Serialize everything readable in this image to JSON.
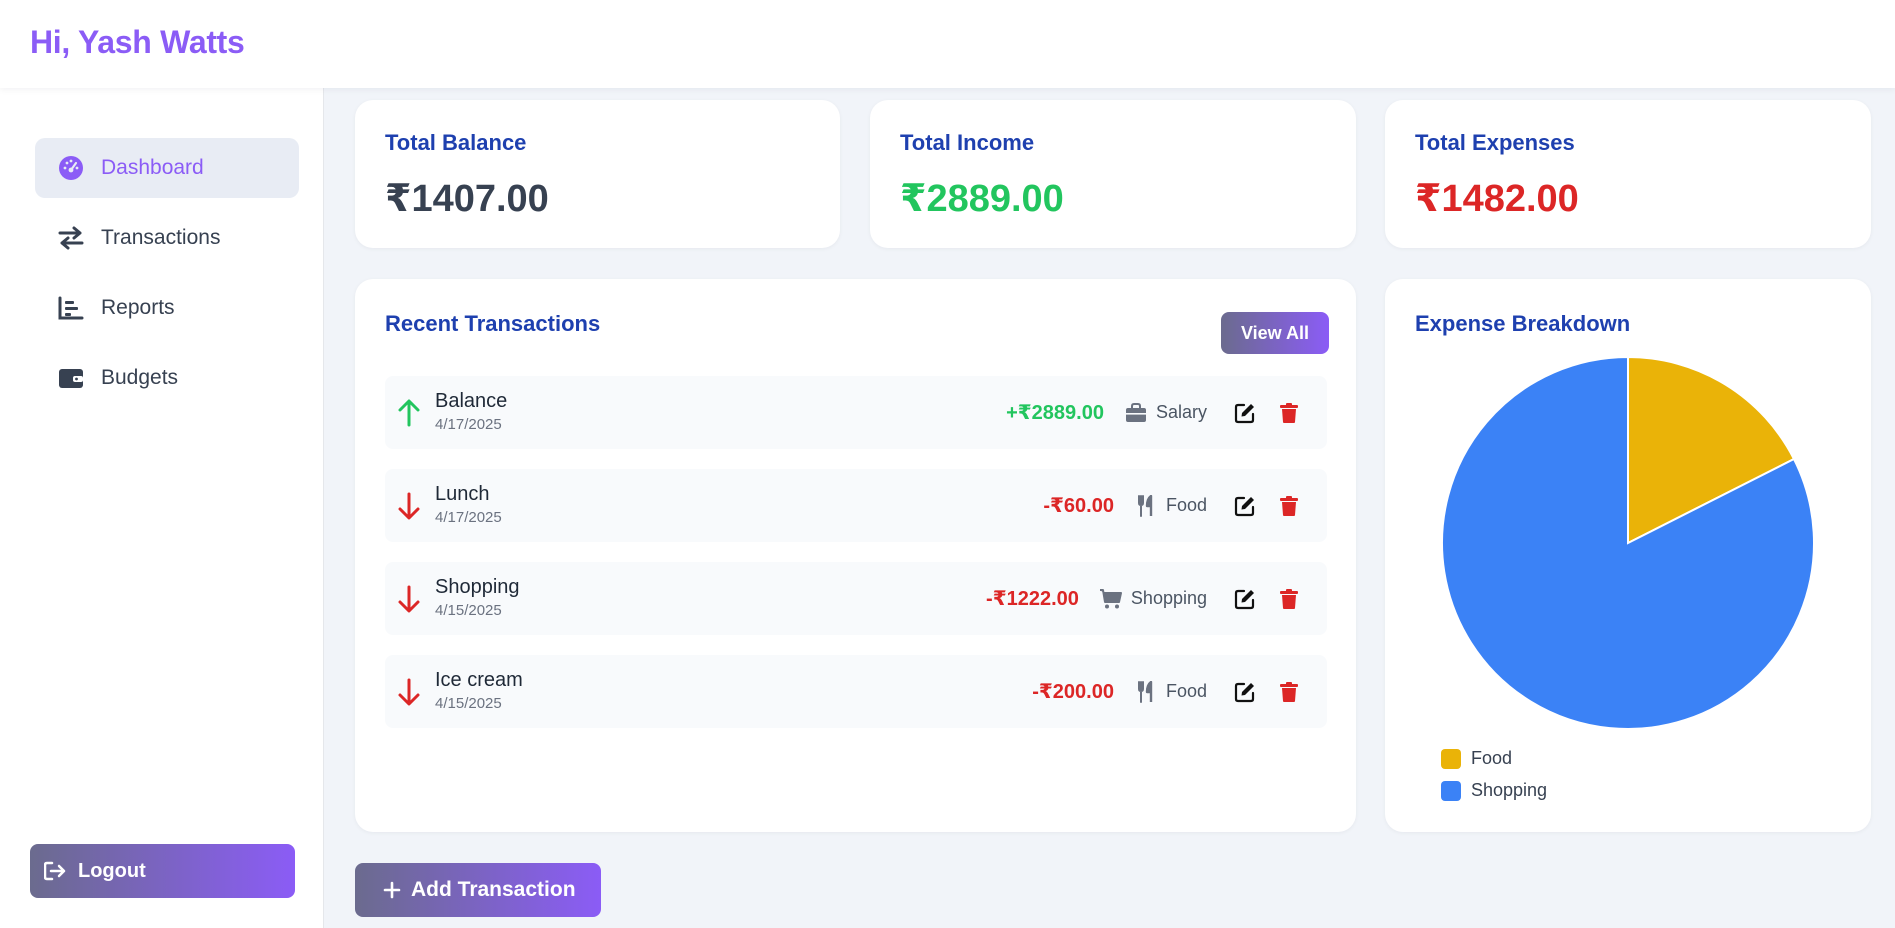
{
  "header": {
    "greeting": "Hi, Yash Watts"
  },
  "sidebar": {
    "items": [
      {
        "label": "Dashboard",
        "icon": "gauge-icon",
        "active": true
      },
      {
        "label": "Transactions",
        "icon": "arrows-exchange-icon",
        "active": false
      },
      {
        "label": "Reports",
        "icon": "bar-chart-icon",
        "active": false
      },
      {
        "label": "Budgets",
        "icon": "wallet-icon",
        "active": false
      }
    ],
    "logout_label": "Logout"
  },
  "stats": {
    "balance": {
      "title": "Total Balance",
      "value": "₹1407.00",
      "color": "#374151"
    },
    "income": {
      "title": "Total Income",
      "value": "₹2889.00",
      "color": "#22c55e"
    },
    "expenses": {
      "title": "Total Expenses",
      "value": "₹1482.00",
      "color": "#dc2626"
    }
  },
  "recent": {
    "title": "Recent Transactions",
    "view_all_label": "View All",
    "transactions": [
      {
        "name": "Balance",
        "date": "4/17/2025",
        "amount": "+₹2889.00",
        "type": "income",
        "category": "Salary",
        "category_icon": "briefcase-icon"
      },
      {
        "name": "Lunch",
        "date": "4/17/2025",
        "amount": "-₹60.00",
        "type": "expense",
        "category": "Food",
        "category_icon": "utensils-icon"
      },
      {
        "name": "Shopping",
        "date": "4/15/2025",
        "amount": "-₹1222.00",
        "type": "expense",
        "category": "Shopping",
        "category_icon": "cart-icon"
      },
      {
        "name": "Ice cream",
        "date": "4/15/2025",
        "amount": "-₹200.00",
        "type": "expense",
        "category": "Food",
        "category_icon": "utensils-icon"
      }
    ]
  },
  "breakdown": {
    "title": "Expense Breakdown"
  },
  "chart_data": {
    "type": "pie",
    "categories": [
      "Food",
      "Shopping"
    ],
    "values": [
      260,
      1222
    ],
    "colors": [
      "#eab308",
      "#3b82f6"
    ],
    "title": "Expense Breakdown",
    "legend": "bottom-left"
  },
  "actions": {
    "add_transaction_label": "Add Transaction"
  },
  "colors": {
    "accent": "#8b5cf6",
    "heading": "#1e40af",
    "income": "#22c55e",
    "expense": "#dc2626"
  }
}
